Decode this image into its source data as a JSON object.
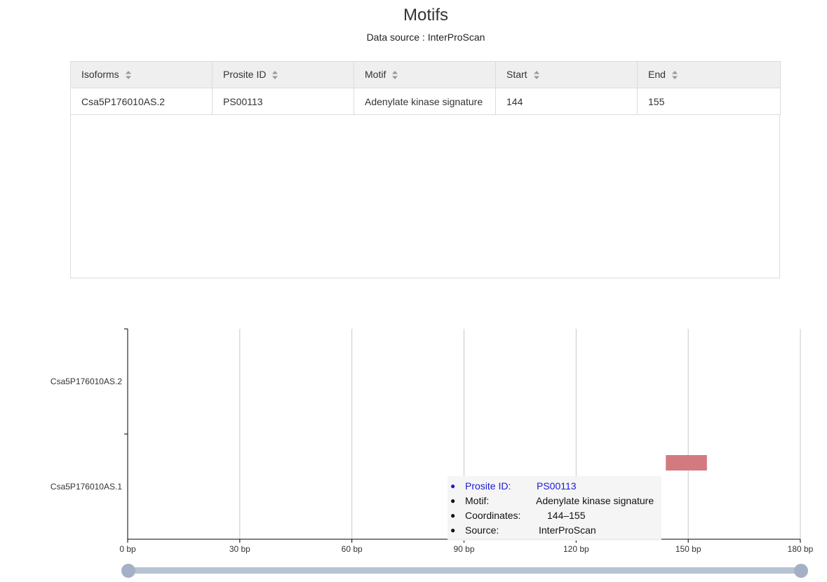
{
  "header": {
    "title": "Motifs",
    "subtitle": "Data source : InterProScan"
  },
  "table": {
    "columns": [
      "Isoforms",
      "Prosite ID",
      "Motif",
      "Start",
      "End"
    ],
    "rows": [
      {
        "isoform": "Csa5P176010AS.2",
        "prosite_id": "PS00113",
        "motif": "Adenylate kinase signature",
        "start": "144",
        "end": "155"
      }
    ]
  },
  "chart_data": {
    "type": "bar",
    "categories": [
      "Csa5P176010AS.2",
      "Csa5P176010AS.1"
    ],
    "xlim": [
      0,
      180
    ],
    "x_ticks": [
      "0 bp",
      "30 bp",
      "60 bp",
      "90 bp",
      "120 bp",
      "150 bp",
      "180 bp"
    ],
    "x_tick_values": [
      0,
      30,
      60,
      90,
      120,
      150,
      180
    ],
    "grid": true,
    "series": [
      {
        "category": "Csa5P176010AS.1",
        "start": 144,
        "end": 155,
        "color": "#d37a80"
      }
    ]
  },
  "tooltip": {
    "rows": [
      {
        "label": "Prosite ID:",
        "value": "PS00113"
      },
      {
        "label": "Motif:",
        "value": "Adenylate kinase signature"
      },
      {
        "label": "Coordinates:",
        "value": "144–155"
      },
      {
        "label": "Source:",
        "value": "InterProScan"
      }
    ]
  },
  "colors": {
    "tooltip_highlight": "#1a1ad6",
    "motif_bar": "#d37a80",
    "slider_track": "#b8c2d4",
    "slider_handle": "#a4b0c6"
  },
  "slider": {
    "range": [
      0,
      1
    ]
  }
}
